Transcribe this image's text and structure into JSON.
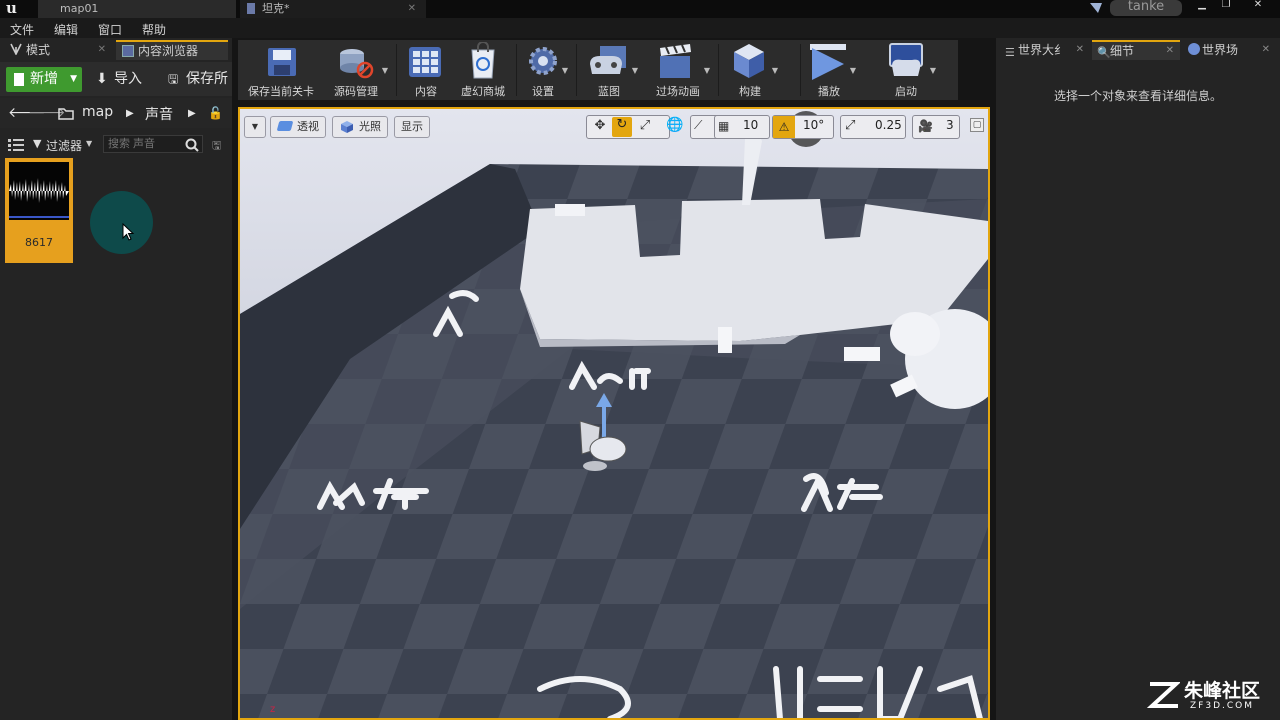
{
  "titlebar": {
    "tabs": [
      {
        "label": "map01",
        "active": true
      },
      {
        "label": "坦克*",
        "active": false
      }
    ],
    "project_name": "tanke"
  },
  "menubar": {
    "items": [
      "文件",
      "编辑",
      "窗口",
      "帮助"
    ]
  },
  "left_panel": {
    "tabs": [
      "模式",
      "内容浏览器"
    ],
    "toolbar": {
      "new": "新增",
      "import": "导入",
      "save": "保存所"
    },
    "breadcrumb": [
      "map",
      "声音"
    ],
    "filter_label": "过滤器",
    "search_placeholder": "搜索 声音",
    "assets": [
      {
        "label": "8617"
      }
    ]
  },
  "main_toolbar": {
    "tools": [
      "保存当前关卡",
      "源码管理",
      "内容",
      "虚幻商城",
      "设置",
      "蓝图",
      "过场动画",
      "构建",
      "播放",
      "启动"
    ]
  },
  "viewport": {
    "view_mode_buttons": [
      "透视",
      "光照",
      "显示"
    ],
    "grid_snap": "10",
    "rotation_snap": "10°",
    "scale_snap": "0.25",
    "camera_speed": "3",
    "floor_labels": [
      "A前",
      "A左",
      "B右"
    ]
  },
  "right_panel": {
    "tabs": [
      "世界大纟",
      "细节",
      "世界场"
    ],
    "details_hint": "选择一个对象来查看详细信息。"
  },
  "watermark": {
    "title": "朱峰社区",
    "url": "ZF3D.COM"
  },
  "colors": {
    "accent": "#e3a60f",
    "new_button": "#3f9a2f",
    "asset_tile": "#e6a01e"
  }
}
